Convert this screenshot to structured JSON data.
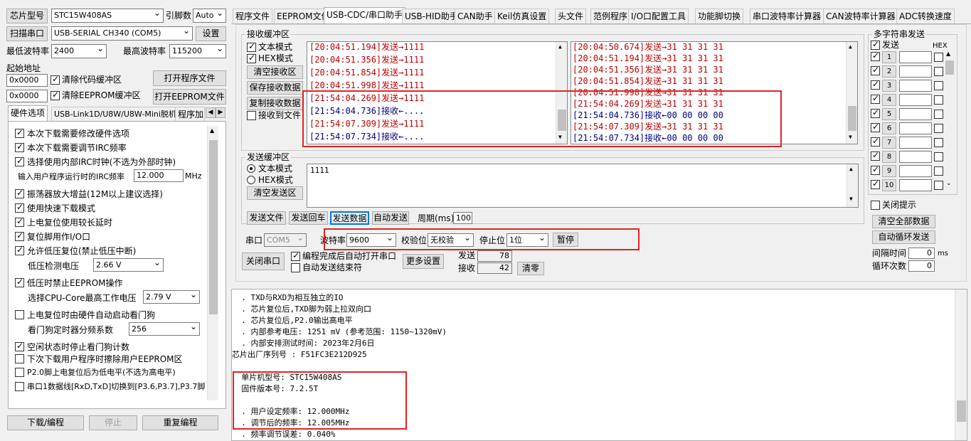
{
  "left": {
    "chip_label": "芯片型号",
    "chip_value": "STC15W408AS",
    "pin_label": "引脚数",
    "pin_value": "Auto",
    "scan_button": "扫描串口",
    "port_value": "USB-SERIAL CH340 (COM5)",
    "settings_button": "设置",
    "min_baud_label": "最低波特率",
    "min_baud_value": "2400",
    "max_baud_label": "最高波特率",
    "max_baud_value": "115200",
    "start_addr_label": "起始地址",
    "addr1": "0x0000",
    "clear_code_label": "清除代码缓冲区",
    "open_prog_button": "打开程序文件",
    "addr2": "0x0000",
    "clear_eeprom_label": "清除EEPROM缓冲区",
    "open_eeprom_button": "打开EEPROM文件",
    "tabs": [
      "硬件选项",
      "USB-Link1D/U8W/U8W-Mini脱机",
      "程序加"
    ],
    "hw": [
      "本次下载需要修改硬件选项",
      "本次下载需要调节IRC频率",
      "选择使用内部IRC时钟(不选为外部时钟)",
      "输入用户程序运行时的IRC频率",
      "振荡器放大增益(12M以上建议选择)",
      "使用快速下载模式",
      "上电复位使用较长延时",
      "复位脚用作I/O口",
      "允许低压复位(禁止低压中断)",
      "低压检测电压",
      "低压时禁止EEPROM操作",
      "选择CPU-Core最高工作电压",
      "上电复位时由硬件自动启动看门狗",
      "看门狗定时器分频系数",
      "空闲状态时停止看门狗计数",
      "下次下载用户程序时擦除用户EEPROM区",
      "P2.0脚上电复位后为低电平(不选为高电平)",
      "串口1数据线[RxD,TxD]切换到[P3.6,P3.7],P3.7脚"
    ],
    "irc_value": "12.000",
    "irc_unit": "MHz",
    "lvd_value": "2.66 V",
    "cpu_volt_value": "2.79 V",
    "wdt_value": "256",
    "download_button": "下载/编程",
    "stop_button": "停止",
    "reprogram_button": "重复编程"
  },
  "tabs": [
    "程序文件",
    "EEPROM文件",
    "USB-CDC/串口助手",
    "USB-HID助手",
    "CAN助手",
    "Keil仿真设置",
    "头文件",
    "范例程序",
    "I/O口配置工具",
    "功能脚切换",
    "串口波特率计算器",
    "CAN波特率计算器",
    "ADC转换速度"
  ],
  "recv": {
    "title": "接收缓冲区",
    "text_mode": "文本模式",
    "hex_mode": "HEX模式",
    "clear_button": "清空接收区",
    "save_button": "保存接收数据",
    "copy_button": "复制接收数据",
    "to_file_label": "接收到文件",
    "left_lines": [
      {
        "t": "[20:04:51.194]",
        "k": "发送→",
        "v": "1111",
        "c": "#c00000"
      },
      {
        "t": "[20:04:51.356]",
        "k": "发送→",
        "v": "1111",
        "c": "#c00000"
      },
      {
        "t": "[20:04:51.854]",
        "k": "发送→",
        "v": "1111",
        "c": "#c00000"
      },
      {
        "t": "[20:04:51.998]",
        "k": "发送→",
        "v": "1111",
        "c": "#c00000"
      },
      {
        "t": "[21:54:04.269]",
        "k": "发送→",
        "v": "1111",
        "c": "#c00000"
      },
      {
        "t": "[21:54:04.736]",
        "k": "接收←",
        "v": "....",
        "c": "#00007f"
      },
      {
        "t": "[21:54:07.309]",
        "k": "发送→",
        "v": "1111",
        "c": "#c00000"
      },
      {
        "t": "[21:54:07.734]",
        "k": "接收←",
        "v": "....",
        "c": "#00007f"
      }
    ],
    "right_lines": [
      {
        "t": "[20:04:50.674]",
        "k": "发送→",
        "v": "31 31 31 31",
        "c": "#c00000"
      },
      {
        "t": "[20:04:51.194]",
        "k": "发送→",
        "v": "31 31 31 31",
        "c": "#c00000"
      },
      {
        "t": "[20:04:51.356]",
        "k": "发送→",
        "v": "31 31 31 31",
        "c": "#c00000"
      },
      {
        "t": "[20:04:51.854]",
        "k": "发送→",
        "v": "31 31 31 31",
        "c": "#c00000"
      },
      {
        "t": "[20:04:51.998]",
        "k": "发送→",
        "v": "31 31 31 31",
        "c": "#c00000"
      },
      {
        "t": "[21:54:04.269]",
        "k": "发送→",
        "v": "31 31 31 31",
        "c": "#c00000"
      },
      {
        "t": "[21:54:04.736]",
        "k": "接收←",
        "v": "00 00 00 00",
        "c": "#00007f"
      },
      {
        "t": "[21:54:07.309]",
        "k": "发送→",
        "v": "31 31 31 31",
        "c": "#c00000"
      },
      {
        "t": "[21:54:07.734]",
        "k": "接收←",
        "v": "00 00 00 00",
        "c": "#00007f"
      }
    ]
  },
  "send": {
    "title": "发送缓冲区",
    "text_mode": "文本模式",
    "hex_mode": "HEX模式",
    "clear_button": "清空发送区",
    "content": "1111",
    "send_file": "发送文件",
    "send_back": "发送回车",
    "send_data": "发送数据",
    "auto_send": "自动发送",
    "period_label": "周期(ms)",
    "period_value": "100"
  },
  "port": {
    "port_label": "串口",
    "port_value": "COM5",
    "baud_label": "波特率",
    "baud_value": "9600",
    "parity_label": "校验位",
    "parity_value": "无校验",
    "stop_label": "停止位",
    "stop_value": "1位",
    "pause_button": "暂停",
    "close_button": "关闭串口",
    "auto_open_label": "编程完成后自动打开串口",
    "auto_end_label": "自动发送结束符",
    "more_button": "更多设置",
    "sent_label": "发送",
    "sent_value": "78",
    "recv_label": "接收",
    "recv_value": "42",
    "clear_button": "清零"
  },
  "multi": {
    "title": "多字符串发送",
    "send_header": "发送",
    "hex_header": "HEX",
    "rows": [
      "1",
      "2",
      "3",
      "4",
      "5",
      "6",
      "7",
      "8",
      "9",
      "10"
    ],
    "close_hint": "关闭提示",
    "clear_all": "清空全部数据",
    "auto_loop": "自动循环发送",
    "interval_label": "间隔时间",
    "interval_value": "0",
    "interval_unit": "ms",
    "loop_label": "循环次数",
    "loop_value": "0"
  },
  "output": {
    "lines": [
      "  . TXD与RXD为相互独立的IO",
      "  . 芯片复位后,TXD脚为弱上拉双向口",
      "  . 芯片复位后,P2.0输出高电平",
      "  . 内部参考电压: 1251 mV (参考范围: 1150~1320mV)",
      "  . 内部安排测试时间: 2023年2月6日",
      "芯片出厂序列号 : F51FC3E212D925",
      "",
      "  单片机型号: STC15W408AS",
      "  固件版本号: 7.2.5T",
      "",
      "  . 用户设定频率: 12.000MHz",
      "  . 调节后的频率: 12.005MHz",
      "  . 频率调节误差: 0.040%"
    ]
  }
}
